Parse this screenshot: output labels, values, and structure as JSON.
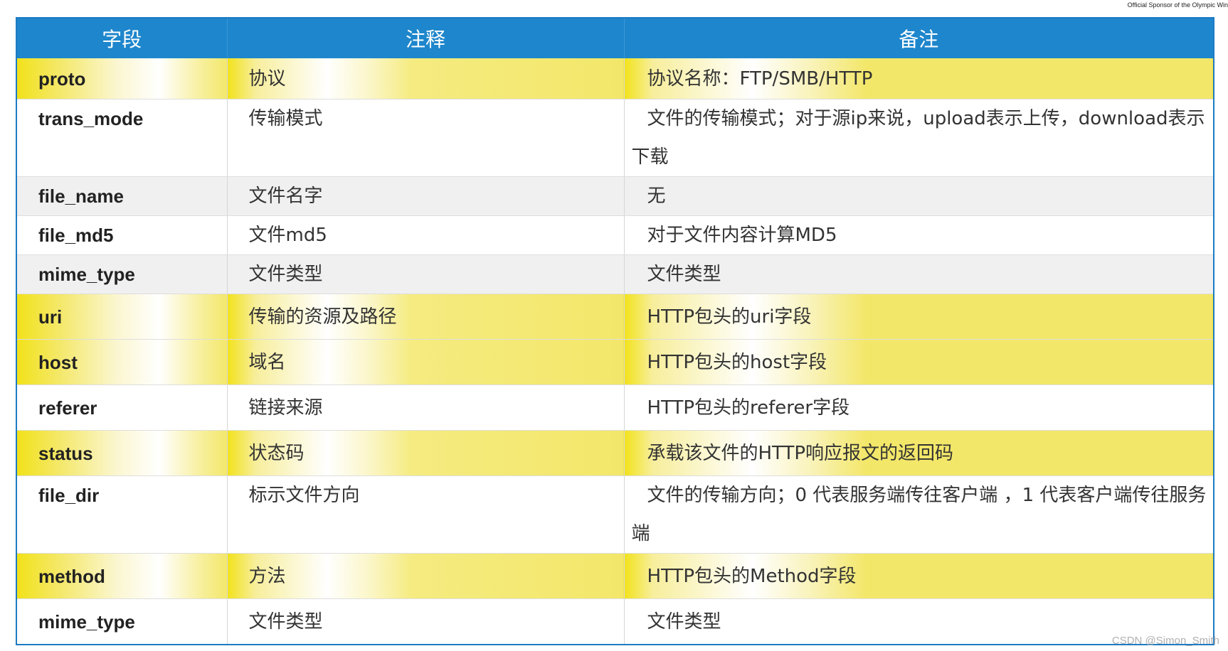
{
  "sponsor_text": "Official Sponsor of the Olympic Win",
  "watermark": "CSDN @Simon_Smith",
  "table": {
    "headers": [
      "字段",
      "注释",
      "备注"
    ],
    "rows": [
      {
        "field": "proto",
        "desc": "协议",
        "note": "协议名称：FTP/SMB/HTTP",
        "style": "yellow"
      },
      {
        "field": "trans_mode",
        "desc": "传输模式",
        "note": "文件的传输模式；对于源ip来说，upload表示上传，download表示下载",
        "style": "white"
      },
      {
        "field": "file_name",
        "desc": "文件名字",
        "note": "无",
        "style": "gray"
      },
      {
        "field": "file_md5",
        "desc": "文件md5",
        "note": "对于文件内容计算MD5",
        "style": "white"
      },
      {
        "field": "mime_type",
        "desc": "文件类型",
        "note": "文件类型",
        "style": "gray"
      },
      {
        "field": "uri",
        "desc": "传输的资源及路径",
        "note": "HTTP包头的uri字段",
        "style": "yellow"
      },
      {
        "field": "host",
        "desc": "域名",
        "note": "HTTP包头的host字段",
        "style": "yellow"
      },
      {
        "field": "referer",
        "desc": "链接来源",
        "note": "HTTP包头的referer字段",
        "style": "white"
      },
      {
        "field": "status",
        "desc": "状态码",
        "note": "承载该文件的HTTP响应报文的返回码",
        "style": "yellow"
      },
      {
        "field": "file_dir",
        "desc": "标示文件方向",
        "note": "文件的传输方向；0 代表服务端传往客户端 ，1 代表客户端传往服务端",
        "style": "white"
      },
      {
        "field": "method",
        "desc": "方法",
        "note": "HTTP包头的Method字段",
        "style": "yellow"
      },
      {
        "field": "mime_type",
        "desc": "文件类型",
        "note": "文件类型",
        "style": "white"
      }
    ]
  }
}
